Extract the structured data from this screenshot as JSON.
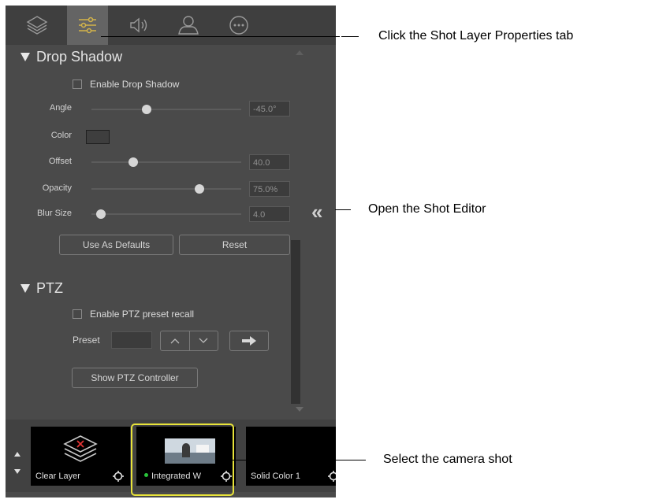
{
  "tabs": [
    {
      "name": "layers-tab",
      "icon": "layers-icon"
    },
    {
      "name": "shot-layer-properties-tab",
      "icon": "sliders-icon",
      "active": true
    },
    {
      "name": "audio-tab",
      "icon": "speaker-icon"
    },
    {
      "name": "user-tab",
      "icon": "user-icon"
    },
    {
      "name": "more-tab",
      "icon": "more-icon"
    }
  ],
  "drop_shadow": {
    "title": "Drop Shadow",
    "enable_label": "Enable Drop Shadow",
    "angle": {
      "label": "Angle",
      "value": "-45.0°",
      "slider_fraction": 0.37
    },
    "color": {
      "label": "Color",
      "swatch": "#3e3e3e"
    },
    "offset": {
      "label": "Offset",
      "value": "40.0",
      "slider_fraction": 0.25
    },
    "opacity": {
      "label": "Opacity",
      "value": "75.0%",
      "slider_fraction": 0.75
    },
    "blur_size": {
      "label": "Blur Size",
      "value": "4.0",
      "slider_fraction": 0.06
    },
    "use_as_defaults_label": "Use As Defaults",
    "reset_label": "Reset"
  },
  "ptz": {
    "title": "PTZ",
    "enable_label": "Enable PTZ preset recall",
    "preset_label": "Preset",
    "show_controller_label": "Show PTZ Controller"
  },
  "shots": [
    {
      "label": "Clear Layer"
    },
    {
      "label": "Integrated W",
      "live": true
    },
    {
      "label": "Solid Color 1"
    }
  ],
  "callouts": {
    "properties_tab": "Click the Shot Layer Properties tab",
    "shot_editor": "Open the Shot Editor",
    "camera_shot": "Select the camera shot"
  },
  "colors": {
    "accent_highlight": "#e8e33a",
    "tab_icon_active": "#d4b44a",
    "live_dot": "#29c43a"
  }
}
